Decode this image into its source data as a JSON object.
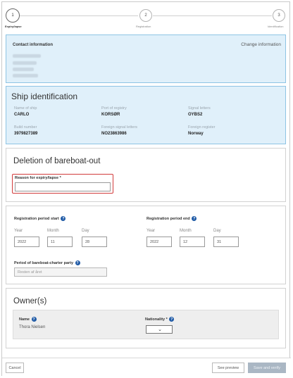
{
  "stepper": {
    "steps": [
      {
        "number": "1",
        "label": "Expiry/lapse",
        "active": true
      },
      {
        "number": "2",
        "label": "Registration",
        "active": false
      },
      {
        "number": "3",
        "label": "Identification",
        "active": false
      }
    ]
  },
  "contact": {
    "title": "Contact information",
    "change_link": "Change information"
  },
  "ship": {
    "title": "Ship identification",
    "fields": [
      {
        "label": "Name of ship",
        "value": "CARLO"
      },
      {
        "label": "Port of registry",
        "value": "KORSØR"
      },
      {
        "label": "Signal letters",
        "value": "OYBS2"
      },
      {
        "label": "Build number",
        "value": "3979827389"
      },
      {
        "label": "Foreign signal letters",
        "value": "NO23863986"
      },
      {
        "label": "Foreign register",
        "value": "Norway"
      }
    ]
  },
  "deletion": {
    "title": "Deletion of bareboat-out",
    "reason_label": "Reason for expiry/lapse",
    "required_mark": "*",
    "reason_value": ""
  },
  "period": {
    "start_label": "Registration period start",
    "end_label": "Registration period end",
    "year_label": "Year",
    "month_label": "Month",
    "day_label": "Day",
    "start": {
      "year": "2022",
      "month": "11",
      "day": "28"
    },
    "end": {
      "year": "2022",
      "month": "12",
      "day": "31"
    },
    "charter_label": "Period of bareboat-charter party",
    "charter_value": "Resten af året"
  },
  "owners": {
    "title": "Owner(s)",
    "name_label": "Name",
    "nationality_label": "Nationality",
    "required_mark": "*",
    "name_value": "Thora Nielsen",
    "nationality_value": ""
  },
  "footer": {
    "cancel": "Cancel",
    "preview": "See preview",
    "save": "Save and verify"
  },
  "colors": {
    "info_bg": "#e0f0fa",
    "info_border": "#8ec4e4",
    "help_icon": "#1f5aa6",
    "error_outline": "#d23b3b",
    "primary_disabled": "#aab7c4"
  }
}
